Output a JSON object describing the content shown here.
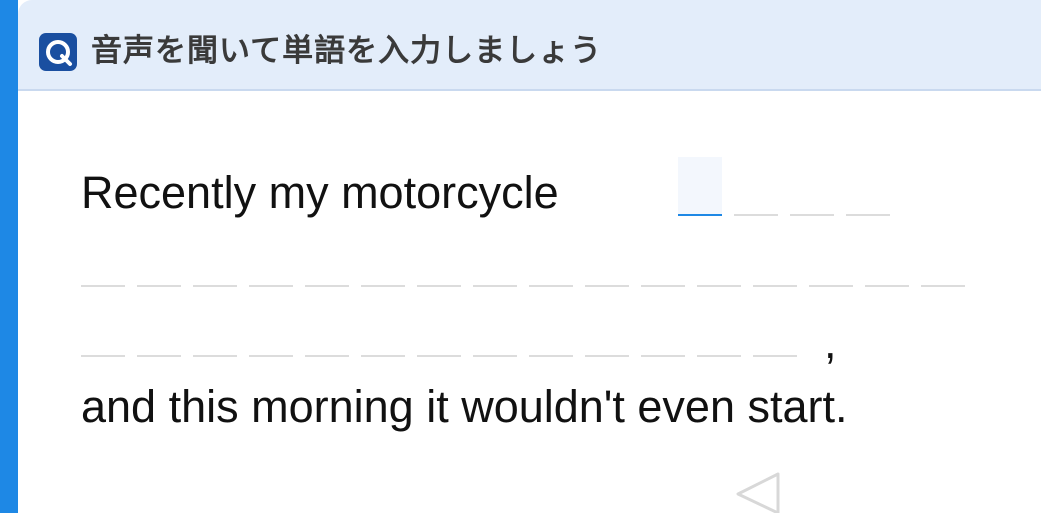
{
  "header": {
    "title": "音声を聞いて単語を入力しましょう",
    "icon": "app-logo-icon"
  },
  "exercise": {
    "sentence_start": "Recently my motorcycle",
    "sentence_end": "and this morning it wouldn't even start.",
    "punctuation": ",",
    "answer_slots": {
      "line1_count": 4,
      "line2_count": 16,
      "line3_count": 13,
      "filled": 0,
      "active_index": 0
    }
  },
  "navigation": {
    "back_icon": "back-triangle-icon"
  },
  "colors": {
    "accent": "#1e88e5",
    "header_bg": "#e3edfa",
    "logo_bg": "#1a4fa0",
    "slot_line": "#dcdcdc"
  }
}
